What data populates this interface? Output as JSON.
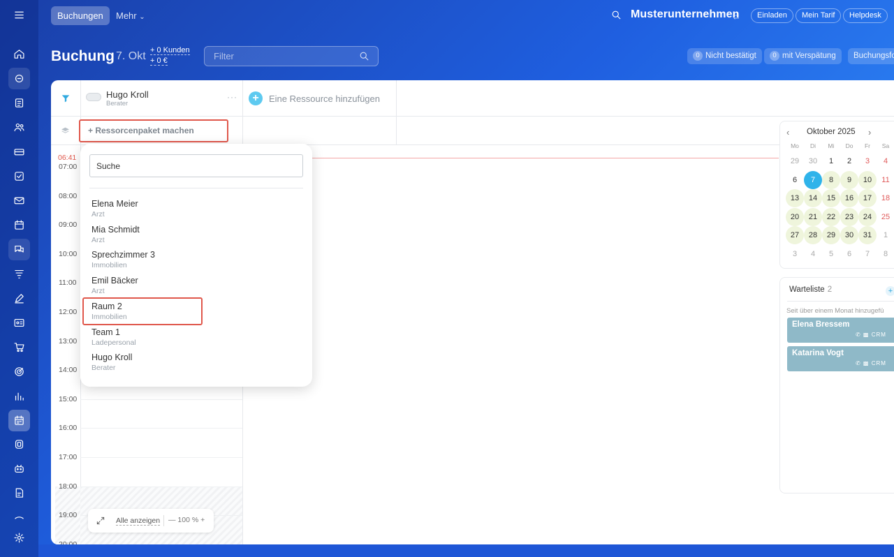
{
  "topbar": {
    "tab_active": "Buchungen",
    "tab_more": "Mehr",
    "company": "Musterunternehmen",
    "pills": [
      "Einladen",
      "Mein Tarif",
      "Helpdesk"
    ]
  },
  "header": {
    "title": "Buchung",
    "date": "7. Okt",
    "customers": "+ 0 Kunden",
    "amount": "+ 0 €",
    "filter_placeholder": "Filter",
    "not_confirmed_count": "0",
    "not_confirmed_label": "Nicht bestätigt",
    "late_count": "0",
    "late_label": "mit Verspätung",
    "booking_form_label": "Buchungsfo"
  },
  "resource": {
    "name": "Hugo Kroll",
    "role": "Berater",
    "menu": "···",
    "add_label": "Eine Ressource hinzufügen",
    "package_button": "+ Ressorcenpaket machen"
  },
  "timeline": {
    "now": "06:41",
    "hours": [
      "07:00",
      "08:00",
      "09:00",
      "10:00",
      "11:00",
      "12:00",
      "13:00",
      "14:00",
      "15:00",
      "16:00",
      "17:00",
      "18:00",
      "19:00",
      "20:00"
    ]
  },
  "zoom": {
    "show_all": "Alle anzeigen",
    "zoom_level": "— 100 % +"
  },
  "dropdown": {
    "search_placeholder": "Suche",
    "items": [
      {
        "name": "Elena Meier",
        "role": "Arzt"
      },
      {
        "name": "Mia Schmidt",
        "role": "Arzt"
      },
      {
        "name": "Sprechzimmer 3",
        "role": "Immobilien"
      },
      {
        "name": "Emil Bäcker",
        "role": "Arzt"
      },
      {
        "name": "Raum 2",
        "role": "Immobilien"
      },
      {
        "name": "Team 1",
        "role": "Ladepersonal"
      },
      {
        "name": "Hugo Kroll",
        "role": "Berater"
      }
    ]
  },
  "calendar": {
    "title": "Oktober 2025",
    "prev": "‹",
    "next": "›",
    "dow": [
      "Mo",
      "Di",
      "Mi",
      "Do",
      "Fr",
      "Sa"
    ],
    "weeks": [
      [
        "29",
        "30",
        "1",
        "2",
        "3",
        "4"
      ],
      [
        "6",
        "7",
        "8",
        "9",
        "10",
        "11"
      ],
      [
        "13",
        "14",
        "15",
        "16",
        "17",
        "18"
      ],
      [
        "20",
        "21",
        "22",
        "23",
        "24",
        "25"
      ],
      [
        "27",
        "28",
        "29",
        "30",
        "31",
        "1"
      ],
      [
        "3",
        "4",
        "5",
        "6",
        "7",
        "8"
      ]
    ]
  },
  "waitlist": {
    "title": "Warteliste",
    "count": "2",
    "subtitle": "Seit über einem Monat hinzugefü",
    "entries": [
      "Elena Bressem",
      "Katarina Vogt"
    ],
    "crm_label": "CRM"
  },
  "colors": {
    "accent": "#2fb3ea",
    "highlight": "#e0574b",
    "available_day": "#eff5dc",
    "waitlist_card": "#8fb9c8"
  }
}
